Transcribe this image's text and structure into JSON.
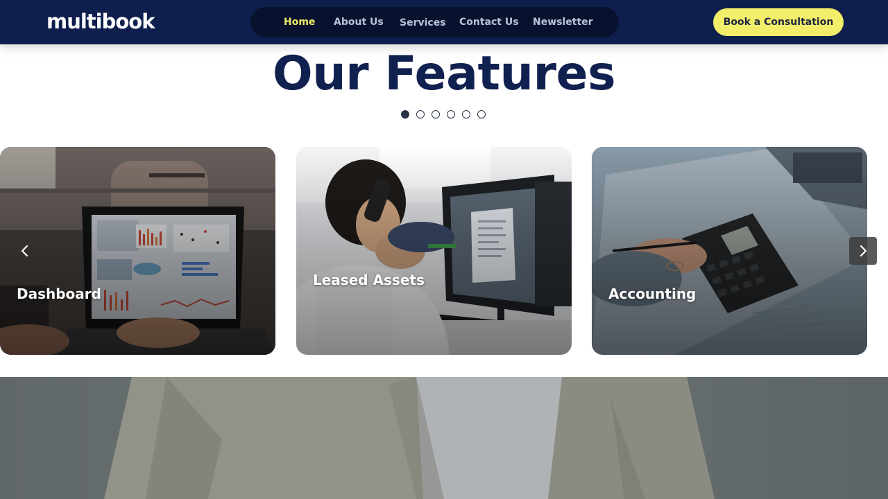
{
  "brand": {
    "logo_text": "multibook"
  },
  "nav": {
    "items": [
      {
        "label": "Home",
        "active": true
      },
      {
        "label": "About Us",
        "active": false
      },
      {
        "label": "Services",
        "active": false
      },
      {
        "label": "Contact Us",
        "active": false
      },
      {
        "label": "Newsletter",
        "active": false
      }
    ],
    "cta_label": "Book a Consultation"
  },
  "features": {
    "title": "Our Features",
    "carousel": {
      "page_count": 6,
      "active_page": 1
    },
    "cards": [
      {
        "title": "Dashboard",
        "image": "person-working-on-laptop-with-charts"
      },
      {
        "title": "Leased Assets",
        "image": "man-on-phone-at-computer-monitor"
      },
      {
        "title": "Accounting",
        "image": "hand-using-calculator-with-documents"
      }
    ]
  },
  "hero": {
    "image": "person-in-beige-jacket"
  },
  "colors": {
    "navy": "#0f1f4d",
    "accent_yellow": "#f3ee6a",
    "heading": "#10204f"
  }
}
